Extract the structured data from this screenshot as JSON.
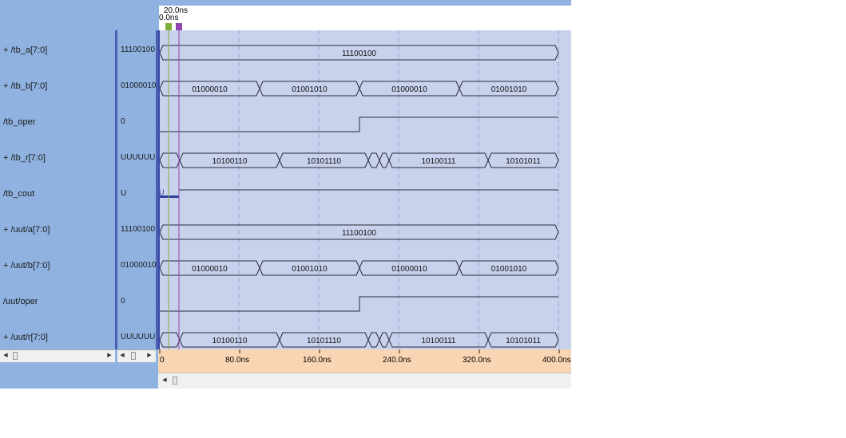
{
  "cursors": {
    "cursor1_time": "20.0ns",
    "cursor0_time": "0.0ns",
    "cursor1_color": "#8e44ad",
    "cursor0_color": "#7fae3c"
  },
  "signals": [
    {
      "name": "+ /tb_a[7:0]",
      "value": "11100100",
      "kind": "bus",
      "segments": [
        {
          "label": "11100100"
        }
      ]
    },
    {
      "name": "+ /tb_b[7:0]",
      "value": "01000010",
      "kind": "bus",
      "segments": [
        {
          "label": "01000010"
        },
        {
          "label": "01001010"
        },
        {
          "label": "01000010"
        },
        {
          "label": "01001010"
        }
      ]
    },
    {
      "name": "/tb_oper",
      "value": "0",
      "kind": "bit"
    },
    {
      "name": "+ /tb_r[7:0]",
      "value": "UUUUUUUU",
      "kind": "bus",
      "segments": [
        {
          "label": ""
        },
        {
          "label": "10100110"
        },
        {
          "label": "10101110"
        },
        {
          "label": ""
        },
        {
          "label": ""
        },
        {
          "label": "10100111"
        },
        {
          "label": "10101011"
        }
      ]
    },
    {
      "name": "/tb_cout",
      "value": "U",
      "kind": "bit",
      "marker": "U"
    },
    {
      "name": "+ /uut/a[7:0]",
      "value": "11100100",
      "kind": "bus",
      "segments": [
        {
          "label": "11100100"
        }
      ]
    },
    {
      "name": "+ /uut/b[7:0]",
      "value": "01000010",
      "kind": "bus",
      "segments": [
        {
          "label": "01000010"
        },
        {
          "label": "01001010"
        },
        {
          "label": "01000010"
        },
        {
          "label": "01001010"
        }
      ]
    },
    {
      "name": "/uut/oper",
      "value": "0",
      "kind": "bit"
    },
    {
      "name": "+ /uut/r[7:0]",
      "value": "UUUUUUUU",
      "kind": "bus",
      "segments": [
        {
          "label": ""
        },
        {
          "label": "10100110"
        },
        {
          "label": "10101110"
        },
        {
          "label": ""
        },
        {
          "label": ""
        },
        {
          "label": "10100111"
        },
        {
          "label": "10101011"
        }
      ]
    }
  ],
  "time_axis": {
    "ticks": [
      "0",
      "80.0ns",
      "160.0ns",
      "240.0ns",
      "320.0ns",
      "400.0ns"
    ]
  },
  "colors": {
    "panel": "#8fb2e0",
    "wave_bg": "#c8d2ec",
    "divider": "#4a5fb0",
    "axis_bg": "#f9d5b3",
    "trace": "#2b2b3b",
    "grid": "#9aa6d8"
  },
  "icons": {
    "scroll_left": "arrow-left-icon",
    "scroll_right": "arrow-right-icon"
  }
}
